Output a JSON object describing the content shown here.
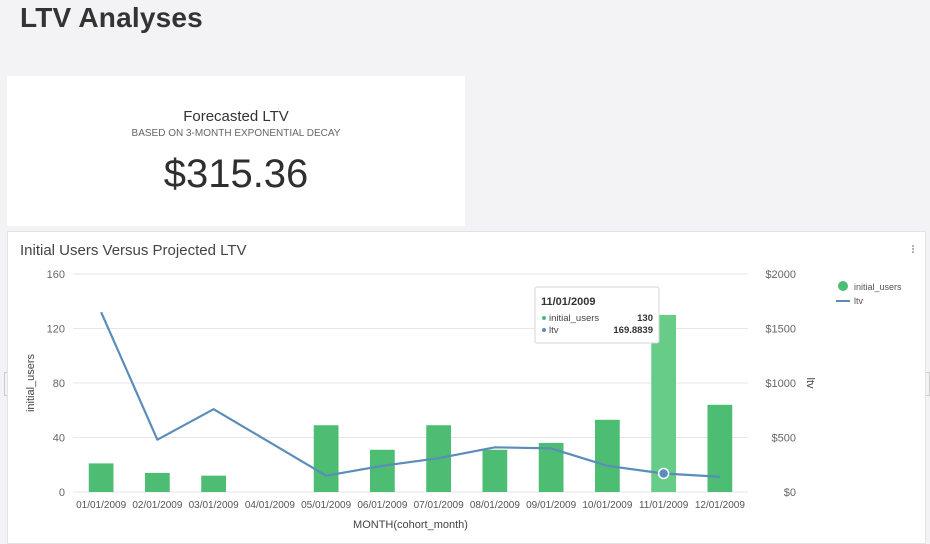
{
  "page": {
    "title": "LTV Analyses"
  },
  "kpi": {
    "title": "Forecasted LTV",
    "subtitle": "BASED ON 3-MONTH EXPONENTIAL DECAY",
    "value": "$315.36"
  },
  "chart_card": {
    "title": "Initial Users Versus Projected LTV"
  },
  "chart_data": {
    "type": "bar+line",
    "title": "Initial Users Versus Projected LTV",
    "xlabel": "MONTH(cohort_month)",
    "ylabel": "initial_users",
    "y2label": "ltv",
    "categories": [
      "01/01/2009",
      "02/01/2009",
      "03/01/2009",
      "04/01/2009",
      "05/01/2009",
      "06/01/2009",
      "07/01/2009",
      "08/01/2009",
      "09/01/2009",
      "10/01/2009",
      "11/01/2009",
      "12/01/2009"
    ],
    "series": [
      {
        "name": "initial_users",
        "type": "bar",
        "axis": "left",
        "color": "#4dbd74",
        "values": [
          21,
          14,
          12,
          0,
          49,
          31,
          49,
          31,
          36,
          53,
          130,
          64
        ]
      },
      {
        "name": "ltv",
        "type": "line",
        "axis": "right",
        "color": "#5b8db8",
        "values": [
          1650,
          480,
          760,
          null,
          150,
          240,
          310,
          410,
          400,
          240,
          169.8839,
          140
        ]
      }
    ],
    "ylim": [
      0,
      160
    ],
    "yticks": [
      "0",
      "40",
      "80",
      "120",
      "160"
    ],
    "y2lim": [
      0,
      2000
    ],
    "y2ticks": [
      "$0",
      "$500",
      "$1000",
      "$1500",
      "$2000"
    ],
    "grid": true,
    "legend_position": "top-right",
    "highlight_color": "#66cc88",
    "tooltip": {
      "category": "11/01/2009",
      "rows": [
        {
          "name": "initial_users",
          "value": "130",
          "color": "#4dbd74"
        },
        {
          "name": "ltv",
          "value": "169.8839",
          "color": "#5b8db8"
        }
      ]
    }
  }
}
